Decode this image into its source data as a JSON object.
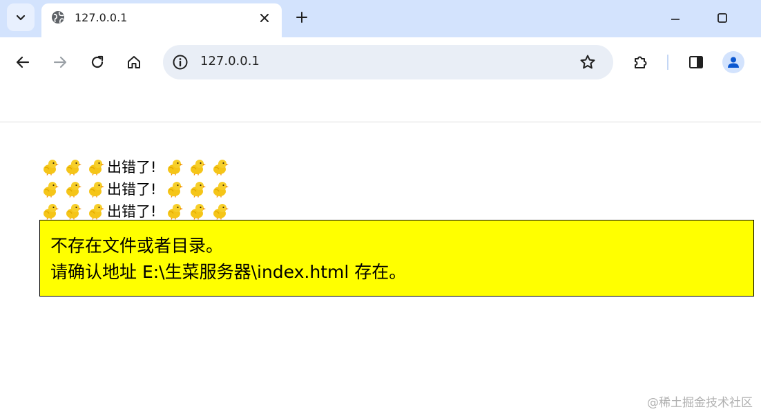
{
  "browser": {
    "tab": {
      "title": "127.0.0.1",
      "favicon": "globe-icon"
    },
    "omnibox": {
      "url": "127.0.0.1"
    },
    "colors": {
      "tab_strip": "#d3e3fd",
      "omnibox": "#e9eef6",
      "accent": "#0b57d0"
    }
  },
  "page": {
    "error_lines": [
      {
        "prefix_icons": [
          "chick-emoji",
          "chick-emoji",
          "chick-emoji"
        ],
        "text": "出错了!",
        "suffix_icons": [
          "chick-emoji",
          "chick-emoji",
          "chick-emoji"
        ]
      },
      {
        "prefix_icons": [
          "chick-emoji",
          "chick-emoji",
          "chick-emoji"
        ],
        "text": "出错了!",
        "suffix_icons": [
          "chick-emoji",
          "chick-emoji",
          "chick-emoji"
        ]
      },
      {
        "prefix_icons": [
          "chick-emoji",
          "chick-emoji",
          "chick-emoji"
        ],
        "text": "出错了!",
        "suffix_icons": [
          "chick-emoji",
          "chick-emoji",
          "chick-emoji"
        ]
      }
    ],
    "message": {
      "line1": "不存在文件或者目录。",
      "line2": "请确认地址 E:\\生菜服务器\\index.html 存在。",
      "background": "#ffff00"
    },
    "watermark": "@稀土掘金技术社区"
  }
}
